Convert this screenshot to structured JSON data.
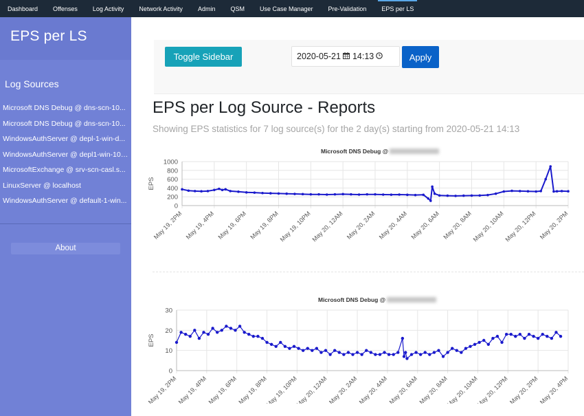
{
  "nav": {
    "items": [
      "Dashboard",
      "Offenses",
      "Log Activity",
      "Network Activity",
      "Admin",
      "QSM",
      "Use Case Manager",
      "Pre-Validation",
      "EPS per LS"
    ],
    "active_index": 8
  },
  "sidebar": {
    "title": "EPS per LS",
    "section_title": "Log Sources",
    "items": [
      "Microsoft DNS Debug @ dns-scn-10...",
      "Microsoft DNS Debug @ dns-scn-10...",
      "WindowsAuthServer @ depl-1-win-d...",
      "WindowsAuthServer @ depl1-win-10.1...",
      "MicrosoftExchange @ srv-scn-casl.s...",
      "LinuxServer @ localhost",
      "WindowsAuthServer @ default-1-win..."
    ],
    "about_label": "About"
  },
  "toolbar": {
    "toggle_label": "Toggle Sidebar",
    "date_value": "2020-05-21",
    "time_value": "14:13",
    "calendar_icon": "calendar-icon",
    "clock_icon": "clock-icon",
    "apply_label": "Apply"
  },
  "main": {
    "title": "EPS per Log Source - Reports",
    "subtitle": "Showing EPS statistics for 7 log source(s) for the 2 day(s) starting from 2020-05-21 14:13"
  },
  "colors": {
    "nav_bg": "#1d2a38",
    "sidebar_bg": "#7181d6",
    "toggle_btn": "#17a2b8",
    "apply_btn": "#0a62c8",
    "series": "#1a1acc"
  },
  "chart_data": [
    {
      "type": "line",
      "title": "Microsoft DNS Debug @",
      "ylabel": "EPS",
      "ylim": [
        0,
        1000
      ],
      "yticks": [
        0,
        200,
        400,
        600,
        800,
        1000
      ],
      "xlim": [
        0,
        24
      ],
      "xticks": [
        "May 19, 2PM",
        "May 19, 4PM",
        "May 19, 6PM",
        "May 19, 8PM",
        "May 19, 10PM",
        "May 20, 12AM",
        "May 20, 2AM",
        "May 20, 4AM",
        "May 20, 6AM",
        "May 20, 8AM",
        "May 20, 10AM",
        "May 20, 12PM",
        "May 20, 2PM"
      ],
      "tick_hours": [
        0,
        2,
        4,
        6,
        8,
        10,
        12,
        14,
        16,
        18,
        20,
        22,
        24
      ],
      "series": [
        {
          "x": [
            0,
            0.4,
            0.8,
            1.2,
            1.6,
            2.0,
            2.3,
            2.5,
            2.7,
            3.0,
            3.5,
            4.0,
            4.5,
            5.0,
            5.5,
            6.0,
            6.5,
            7.0,
            7.5,
            8.0,
            8.5,
            9.0,
            9.5,
            10.0,
            10.5,
            11.0,
            11.5,
            12.0,
            12.5,
            13.0,
            13.5,
            14.0,
            14.5,
            15.0,
            15.3,
            15.45,
            15.55,
            15.7,
            16.0,
            16.5,
            17.0,
            17.5,
            18.0,
            18.5,
            19.0,
            19.5,
            20.0,
            20.5,
            21.0,
            21.5,
            22.0,
            22.3,
            22.6,
            22.9,
            23.1,
            23.3,
            23.6,
            24.0
          ],
          "y": [
            370,
            340,
            330,
            325,
            330,
            355,
            380,
            355,
            370,
            330,
            315,
            300,
            295,
            285,
            280,
            275,
            270,
            265,
            260,
            255,
            255,
            250,
            255,
            260,
            255,
            250,
            255,
            255,
            250,
            248,
            250,
            245,
            240,
            245,
            160,
            110,
            430,
            270,
            230,
            225,
            220,
            225,
            228,
            230,
            240,
            270,
            320,
            335,
            330,
            325,
            320,
            330,
            600,
            890,
            320,
            325,
            330,
            325
          ]
        }
      ]
    },
    {
      "type": "scatter",
      "title": "Microsoft DNS Debug @",
      "ylabel": "EPS",
      "ylim": [
        0,
        30
      ],
      "yticks": [
        0,
        10,
        20,
        30
      ],
      "xlim": [
        0,
        26
      ],
      "xticks": [
        "May 19, 2PM",
        "May 19, 4PM",
        "May 19, 6PM",
        "May 19, 8PM",
        "May 19, 10PM",
        "May 20, 12AM",
        "May 20, 2AM",
        "May 20, 4AM",
        "May 20, 6AM",
        "May 20, 8AM",
        "May 20, 10AM",
        "May 20, 12PM",
        "May 20, 2PM",
        "May 20, 4PM"
      ],
      "tick_hours": [
        0,
        2,
        4,
        6,
        8,
        10,
        12,
        14,
        16,
        18,
        20,
        22,
        24,
        26
      ],
      "series": [
        {
          "x": [
            0,
            0.3,
            0.6,
            0.9,
            1.2,
            1.5,
            1.8,
            2.1,
            2.4,
            2.7,
            3.0,
            3.3,
            3.6,
            3.9,
            4.2,
            4.5,
            4.8,
            5.1,
            5.4,
            5.7,
            6.0,
            6.3,
            6.6,
            6.9,
            7.2,
            7.5,
            7.8,
            8.1,
            8.4,
            8.7,
            9.0,
            9.3,
            9.6,
            9.9,
            10.2,
            10.5,
            10.8,
            11.1,
            11.4,
            11.7,
            12.0,
            12.3,
            12.6,
            12.9,
            13.2,
            13.5,
            13.8,
            14.1,
            14.4,
            14.7,
            15.0,
            15.1,
            15.2,
            15.3,
            15.6,
            15.9,
            16.2,
            16.5,
            16.8,
            17.1,
            17.4,
            17.7,
            18.0,
            18.3,
            18.6,
            18.9,
            19.2,
            19.5,
            19.8,
            20.1,
            20.4,
            20.7,
            21.0,
            21.3,
            21.6,
            21.9,
            22.2,
            22.5,
            22.8,
            23.1,
            23.4,
            23.7,
            24.0,
            24.3,
            24.6,
            24.9,
            25.2,
            25.5
          ],
          "y": [
            14,
            19,
            18,
            17,
            20,
            16,
            19,
            18,
            21,
            19,
            20,
            22,
            21,
            20,
            22,
            19,
            18,
            17,
            17,
            16,
            14,
            13,
            12,
            14,
            12,
            11,
            12,
            11,
            10,
            11,
            10,
            11,
            9,
            10,
            8,
            10,
            9,
            8,
            9,
            8,
            9,
            8,
            10,
            9,
            8,
            8,
            9,
            8,
            8,
            9,
            16,
            7,
            9,
            6,
            8,
            9,
            8,
            9,
            8,
            9,
            10,
            7,
            9,
            11,
            10,
            9,
            11,
            12,
            13,
            14,
            15,
            13,
            16,
            17,
            14,
            18,
            18,
            17,
            18,
            16,
            18,
            17,
            16,
            18,
            17,
            16,
            19,
            17
          ]
        }
      ]
    }
  ]
}
